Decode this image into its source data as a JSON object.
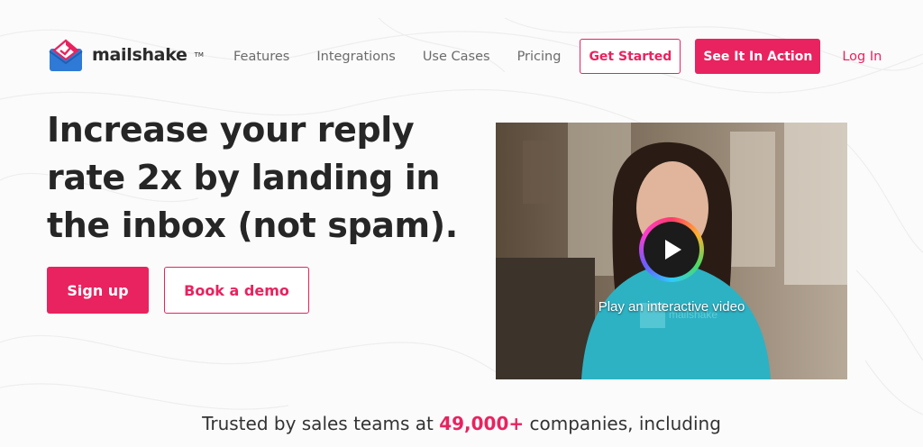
{
  "brand": {
    "name": "mailshake",
    "tm": "TM",
    "accent": "#e8235f"
  },
  "nav": {
    "links": [
      "Features",
      "Integrations",
      "Use Cases",
      "Pricing"
    ],
    "get_started": "Get Started",
    "see_it": "See It In Action",
    "login": "Log In"
  },
  "hero": {
    "headline": "Increase your reply rate 2x by landing in the inbox (not spam).",
    "signup": "Sign up",
    "demo": "Book a demo"
  },
  "video": {
    "caption": "Play an interactive video",
    "icon": "play-icon"
  },
  "trusted": {
    "prefix": "Trusted by sales teams at ",
    "count": "49,000+",
    "suffix": " companies, including"
  }
}
